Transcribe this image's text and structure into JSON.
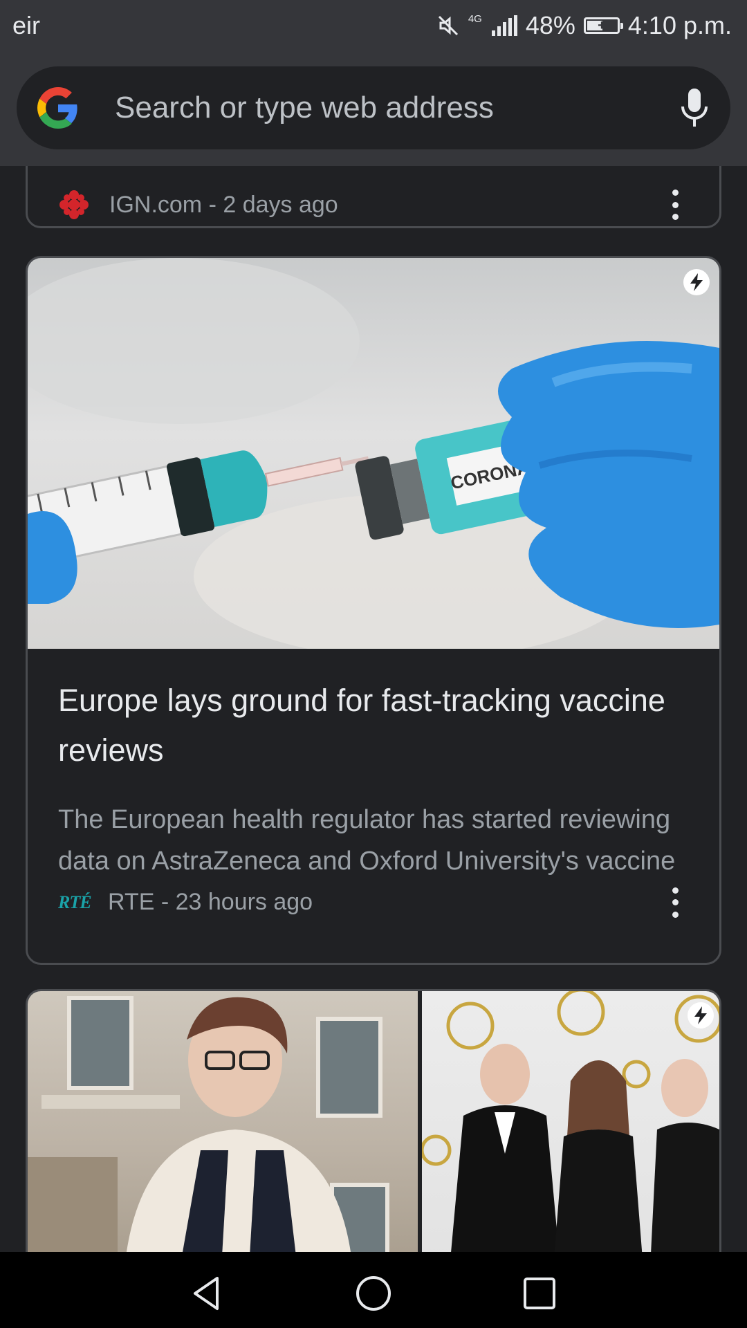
{
  "status_bar": {
    "carrier": "eir",
    "network": "4G",
    "battery": "48%",
    "battery_level": 0.48,
    "time": "4:10 p.m."
  },
  "toolbar": {
    "search_placeholder": "Search or type web address",
    "icons": [
      "google-icon",
      "mic-icon"
    ]
  },
  "feed": {
    "cards": [
      {
        "source": "IGN.com - 2 days ago"
      },
      {
        "headline": "Europe lays ground for fast-tracking vaccine reviews",
        "snippet": "The European health regulator has started reviewing data on AstraZeneca and Oxford University's vaccine",
        "source_logo": "RTÉ",
        "source": "RTE - 23 hours ago",
        "image_label": "CORONAVIRUS"
      },
      {
        "image": "two-photo-collage"
      }
    ]
  },
  "colors": {
    "background": "#202124",
    "toolbar": "#35363a",
    "card_border": "#4a4c50",
    "rte_accent": "#1aa2a8",
    "ign_red": "#d3252b"
  },
  "nav_bar": {
    "buttons": [
      "back-icon",
      "home-icon",
      "recents-icon"
    ]
  }
}
